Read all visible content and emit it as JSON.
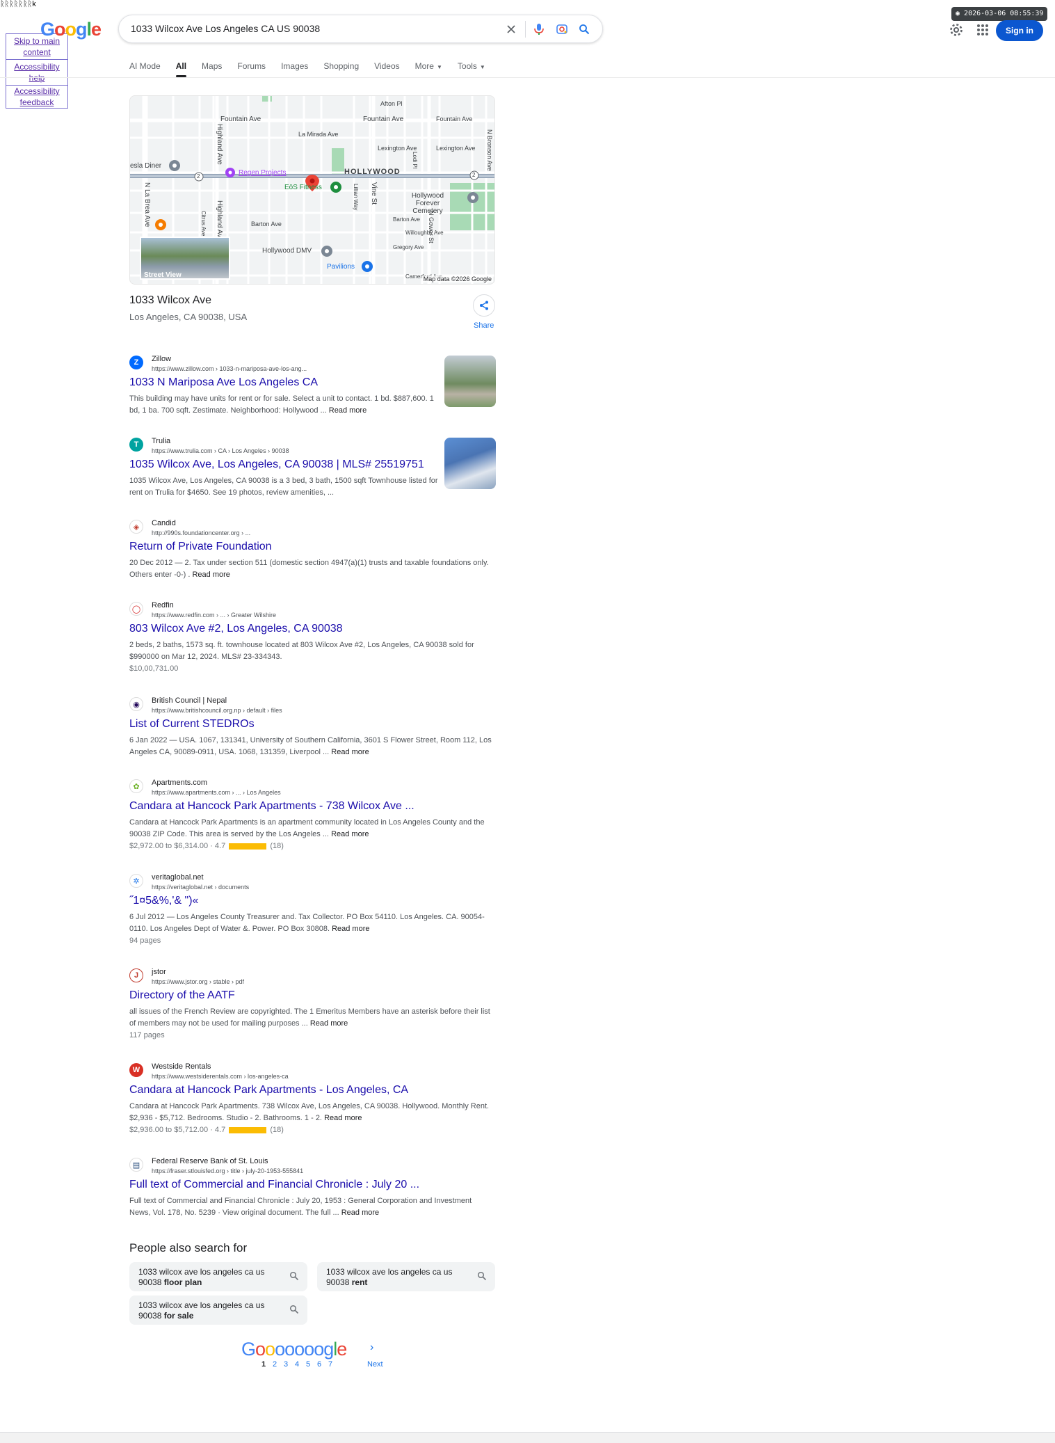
{
  "corner": {
    "junk_text": "ᚱᚱᚱᚱᚱᚱᚱk",
    "skip_to_main": "Skip to main content",
    "accessibility_help": "Accessibility help",
    "accessibility_feedback": "Accessibility feedback"
  },
  "logo": {
    "text": "Google"
  },
  "search": {
    "query": "1033 Wilcox Ave Los Angeles CA US 90038"
  },
  "timestamp": "2026-03-06 08:55:39",
  "header": {
    "signin_label": "Sign in"
  },
  "tabs": [
    {
      "label": "AI Mode"
    },
    {
      "label": "All"
    },
    {
      "label": "Maps"
    },
    {
      "label": "Forums"
    },
    {
      "label": "Images"
    },
    {
      "label": "Shopping"
    },
    {
      "label": "Videos"
    },
    {
      "label": "More"
    },
    {
      "label": "Tools"
    }
  ],
  "map": {
    "labels": {
      "fountain1": "Fountain Ave",
      "fountain2": "Fountain Ave",
      "fountain3": "Fountain Ave",
      "afton": "Afton Pl",
      "lamirada": "La Mirada Ave",
      "lexington1": "Lexington Ave",
      "lexington2": "Lexington Ave",
      "hollywood": "HOLLYWOOD",
      "teslaDiner": "esla Diner",
      "regen": "Regen Projects",
      "eos": "EōS Fitness",
      "forever": "Hollywood Forever Cemetery",
      "barton1": "Barton Ave",
      "barton2": "Barton Ave",
      "willoughby": "Willoughby Ave",
      "gregory": "Gregory Ave",
      "dmv": "Hollywood DMV",
      "pavilions": "Pavilions",
      "camerford": "Camerford Ave",
      "highland1": "Highland Ave",
      "highland2": "Highland Ave",
      "labrea": "N La Brea Ave",
      "vine": "Vine St",
      "lillian": "Lillian Way",
      "citrus": "Citrus Ave",
      "gower": "N Gower St",
      "bronson": "N Bronson Ave",
      "lodi": "Lodi Pl",
      "shield1": "2",
      "shield2": "2"
    },
    "streetview_label": "Street View",
    "credit": "Map data ©2026 Google"
  },
  "place": {
    "title": "1033 Wilcox Ave",
    "address": "Los Angeles, CA 90038, USA",
    "share_label": "Share"
  },
  "results": [
    {
      "site": "Zillow",
      "url": "https://www.zillow.com › 1033-n-mariposa-ave-los-ang...",
      "title": "1033 N Mariposa Ave Los Angeles CA",
      "snippet": "This building may have units for rent or for sale. Select a unit to contact. 1 bd. $887,600. 1 bd, 1 ba. 700 sqft. Zestimate. Neighborhood: Hollywood ...",
      "more": "Read more",
      "extra": ""
    },
    {
      "site": "Trulia",
      "url": "https://www.trulia.com › CA › Los Angeles › 90038",
      "title": "1035 Wilcox Ave, Los Angeles, CA 90038 | MLS# 25519751",
      "snippet": "1035 Wilcox Ave, Los Angeles, CA 90038 is a 3 bed, 3 bath, 1500 sqft Townhouse listed for rent on Trulia for $4650. See 19 photos, review amenities, ...",
      "more": "",
      "extra": ""
    },
    {
      "site": "Candid",
      "url": "http://990s.foundationcenter.org › ...",
      "title": "Return of Private Foundation",
      "snippet": "20 Dec 2012 — 2. Tax under section 511 (domestic section 4947(a)(1) trusts and taxable foundations only. Others enter -0-) .",
      "more": "Read more",
      "extra": ""
    },
    {
      "site": "Redfin",
      "url": "https://www.redfin.com › ... › Greater Wilshire",
      "title": "803 Wilcox Ave #2, Los Angeles, CA 90038",
      "snippet": "2 beds, 2 baths, 1573 sq. ft. townhouse located at 803 Wilcox Ave #2, Los Angeles, CA 90038 sold for $990000 on Mar 12, 2024. MLS# 23-334343.",
      "more": "",
      "extra": "$10,00,731.00"
    },
    {
      "site": "British Council | Nepal",
      "url": "https://www.britishcouncil.org.np › default › files",
      "title": "List of Current STEDROs",
      "snippet": "6 Jan 2022 — USA. 1067, 131341, University of Southern California, 3601 S Flower Street, Room 112, Los Angeles CA, 90089-0911, USA. 1068, 131359, Liverpool ...",
      "more": "Read more",
      "extra": ""
    },
    {
      "site": "Apartments.com",
      "url": "https://www.apartments.com › ... › Los Angeles",
      "title": "Candara at Hancock Park Apartments - 738 Wilcox Ave ...",
      "snippet": "Candara at Hancock Park Apartments is an apartment community located in Los Angeles County and the 90038 ZIP Code. This area is served by the Los Angeles ...",
      "more": "Read more",
      "extra_pre": "$2,972.00 to $6,314.00 · 4.7",
      "extra_post": "(18)"
    },
    {
      "site": "veritaglobal.net",
      "url": "https://veritaglobal.net › documents",
      "title": "˝1¤5&%,'& \")«",
      "snippet": "6 Jul 2012 — Los Angeles County Treasurer and. Tax Collector. PO Box 54110. Los Angeles. CA. 90054-0110. Los Angeles Dept of Water &. Power. PO Box 30808.",
      "more": "Read more",
      "extra": "94 pages"
    },
    {
      "site": "jstor",
      "url": "https://www.jstor.org › stable › pdf",
      "title": "Directory of the AATF",
      "snippet": "all issues of the French Review are copyrighted. The 1 Emeritus Members have an asterisk before their list of members may not be used for mailing purposes ...",
      "more": "Read more",
      "extra": "117 pages"
    },
    {
      "site": "Westside Rentals",
      "url": "https://www.westsiderentals.com › los-angeles-ca",
      "title": "Candara at Hancock Park Apartments - Los Angeles, CA",
      "snippet": "Candara at Hancock Park Apartments. 738 Wilcox Ave, Los Angeles, CA 90038. Hollywood. Monthly Rent. $2,936 - $5,712. Bedrooms. Studio - 2. Bathrooms. 1 - 2.",
      "more": "Read more",
      "extra_pre": "$2,936.00 to $5,712.00 · 4.7",
      "extra_post": "(18)"
    },
    {
      "site": "Federal Reserve Bank of St. Louis",
      "url": "https://fraser.stlouisfed.org › title › july-20-1953-555841",
      "title": "Full text of Commercial and Financial Chronicle : July 20 ...",
      "snippet": "Full text of Commercial and Financial Chronicle : July 20, 1953 : General Corporation and Investment News, Vol. 178, No. 5239 · View original document. The full ...",
      "more": "Read more",
      "extra": ""
    }
  ],
  "people_also_search": {
    "title": "People also search for",
    "chips": [
      {
        "prefix": "1033 wilcox ave los angeles ca us 90038",
        "bold": "floor plan"
      },
      {
        "prefix": "1033 wilcox ave los angeles ca us 90038",
        "bold": "rent"
      },
      {
        "prefix": "1033 wilcox ave los angeles ca us 90038",
        "bold": "for sale"
      }
    ]
  },
  "pagination": {
    "logo": "Goooooooogle",
    "pages": [
      "1",
      "2",
      "3",
      "4",
      "5",
      "6",
      "7"
    ],
    "next": "Next"
  },
  "colors": {
    "link": "#1a0dab",
    "accent": "#0b57d0",
    "star": "#fbbc04"
  }
}
